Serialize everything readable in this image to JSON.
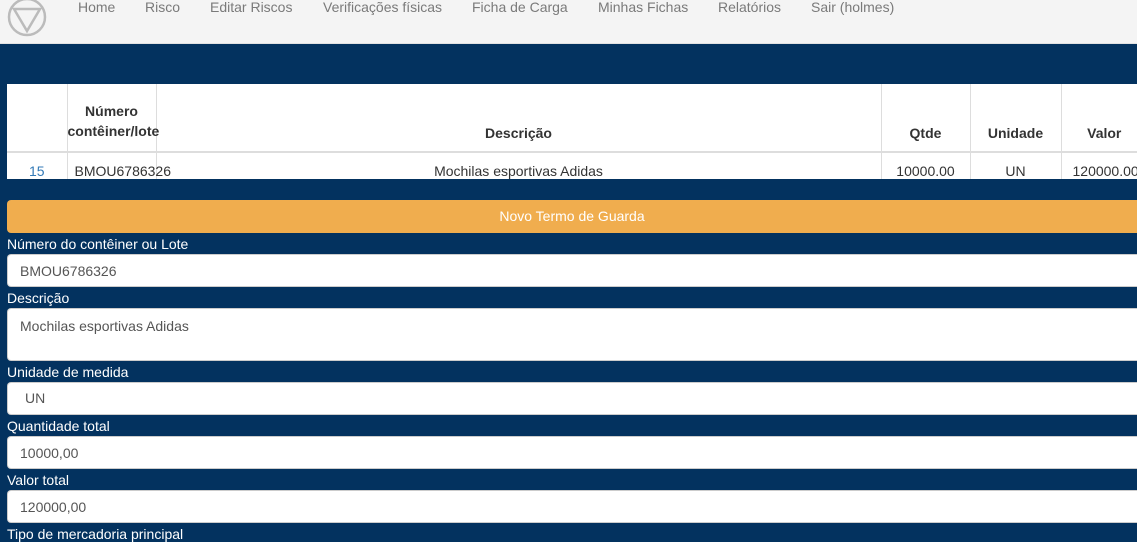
{
  "nav": {
    "items": [
      "Home",
      "Risco",
      "Editar Riscos",
      "Verificações físicas",
      "Ficha de Carga",
      "Minhas Fichas",
      "Relatórios",
      "Sair (holmes)"
    ]
  },
  "table": {
    "headers": [
      "",
      "Número contêiner/lote",
      "Descrição",
      "Qtde",
      "Unidade",
      "Valor"
    ],
    "rows": [
      {
        "id": "15",
        "container": "BMOU6786326",
        "descricao": "Mochilas esportivas Adidas",
        "qtde": "10000.00",
        "unidade": "UN",
        "valor": "120000.00"
      }
    ]
  },
  "new_button_label": "Novo Termo de Guarda",
  "form": {
    "container_label": "Número do contêiner ou Lote",
    "container_value": "BMOU6786326",
    "descricao_label": "Descrição",
    "descricao_value": "Mochilas esportivas Adidas",
    "unidade_label": "Unidade de medida",
    "unidade_value": "UN",
    "quantidade_label": "Quantidade total",
    "quantidade_value": "10000,00",
    "valor_label": "Valor total",
    "valor_value": "120000,00",
    "tipo_label": "Tipo de mercadoria principal"
  },
  "colors": {
    "background": "#03325f",
    "navbar": "#f4f4f4",
    "button_orange": "#f0ad4e",
    "link": "#337ab7"
  }
}
